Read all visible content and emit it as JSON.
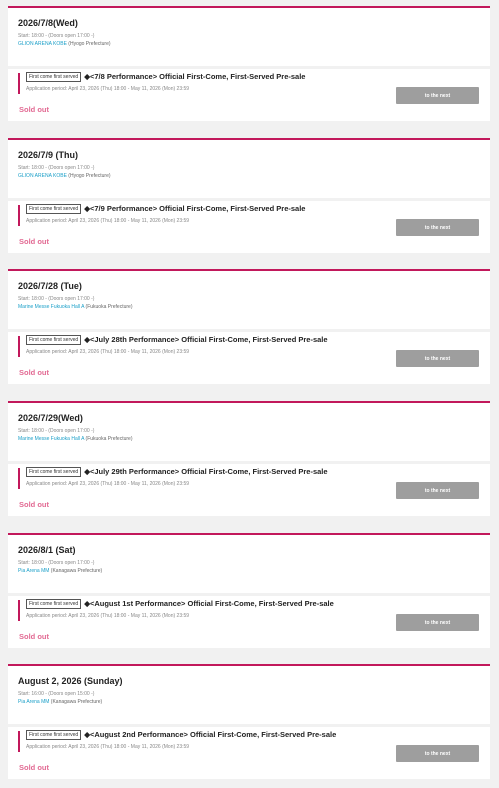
{
  "events": [
    {
      "date": "2026/7/8(Wed)",
      "start": "Start: 18:00 - (Doors open 17:00 -)",
      "venue": "GLION ARENA KOBE",
      "prefecture": "(Hyogo Prefecture)",
      "badge": "First come first served",
      "sale_title": "◆<7/8 Performance> Official First-Come, First-Served Pre-sale",
      "period": "Application period: April 23, 2026 (Thu) 18:00 - May 11, 2026 (Mon) 23:59",
      "button": "to the next",
      "status": "Sold out"
    },
    {
      "date": "2026/7/9 (Thu)",
      "start": "Start: 18:00 - (Doors open 17:00 -)",
      "venue": "GLION ARENA KOBE",
      "prefecture": "(Hyogo Prefecture)",
      "badge": "First come first served",
      "sale_title": "◆<7/9 Performance> Official First-Come, First-Served Pre-sale",
      "period": "Application period: April 23, 2026 (Thu) 18:00 - May 11, 2026 (Mon) 23:59",
      "button": "to the next",
      "status": "Sold out"
    },
    {
      "date": "2026/7/28 (Tue)",
      "start": "Start: 18:00 - (Doors open 17:00 -)",
      "venue": "Marine Messe Fukuoka Hall A",
      "prefecture": "(Fukuoka Prefecture)",
      "badge": "First come first served",
      "sale_title": "◆<July 28th Performance> Official First-Come, First-Served Pre-sale",
      "period": "Application period: April 23, 2026 (Thu) 18:00 - May 11, 2026 (Mon) 23:59",
      "button": "to the next",
      "status": "Sold out"
    },
    {
      "date": "2026/7/29(Wed)",
      "start": "Start: 18:00 - (Doors open 17:00 -)",
      "venue": "Marine Messe Fukuoka Hall A",
      "prefecture": "(Fukuoka Prefecture)",
      "badge": "First come first served",
      "sale_title": "◆<July 29th Performance> Official First-Come, First-Served Pre-sale",
      "period": "Application period: April 23, 2026 (Thu) 18:00 - May 11, 2026 (Mon) 23:59",
      "button": "to the next",
      "status": "Sold out"
    },
    {
      "date": "2026/8/1 (Sat)",
      "start": "Start: 18:00 - (Doors open 17:00 -)",
      "venue": "Pia Arena MM",
      "prefecture": "(Kanagawa Prefecture)",
      "badge": "First come first served",
      "sale_title": "◆<August 1st Performance> Official First-Come, First-Served Pre-sale",
      "period": "Application period: April 23, 2026 (Thu) 18:00 - May 11, 2026 (Mon) 23:59",
      "button": "to the next",
      "status": "Sold out"
    },
    {
      "date": "August 2, 2026 (Sunday)",
      "start": "Start: 16:00 - (Doors open 15:00 -)",
      "venue": "Pia Arena MM",
      "prefecture": "(Kanagawa Prefecture)",
      "badge": "First come first served",
      "sale_title": "◆<August 2nd Performance> Official First-Come, First-Served Pre-sale",
      "period": "Application period: April 23, 2026 (Thu) 18:00 - May 11, 2026 (Mon) 23:59",
      "button": "to the next",
      "status": "Sold out"
    }
  ],
  "colors": {
    "accent": "#c2185b",
    "venue_link": "#1a9fc8",
    "sold_out": "#e26a93",
    "button": "#9e9e9e",
    "background": "#f1f1f1"
  }
}
